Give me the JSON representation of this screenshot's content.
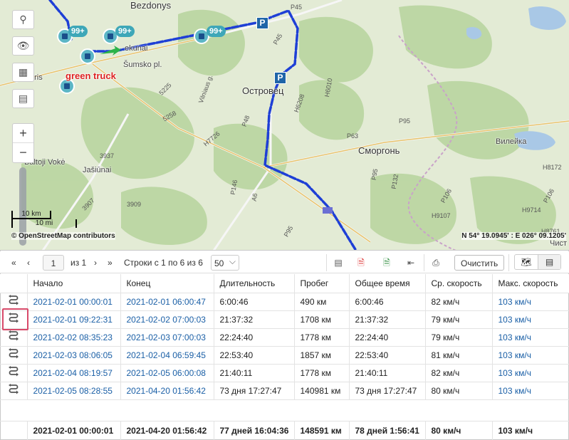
{
  "map": {
    "places": {
      "bezdonys": "Bezdonys",
      "ostrovets": "Островец",
      "smorgon": "Сморгонь",
      "vileyka": "Вилейка",
      "baltoji_voke": "Baltoji Vokė",
      "jasiunai": "Jašiūnai",
      "vilnius_partial": "L",
      "paris_partial": "aris",
      "sumsko": "Šumsko pl.",
      "vilnius_g": "Vilniaus g.",
      "kunai": "ekunai",
      "chist": "Чист"
    },
    "roads": [
      "P45",
      "P45",
      "H6010",
      "H6208",
      "P48",
      "P95",
      "P63",
      "P95",
      "P132",
      "H7726",
      "5225",
      "5258",
      "3937",
      "3907",
      "3909",
      "P146",
      "A6",
      "P95",
      "P106",
      "H9107",
      "H9714",
      "H8172",
      "H8761",
      "P106"
    ],
    "truck_label": "green truck",
    "badges": [
      "99+",
      "99+",
      "99+"
    ],
    "parking_label": "P",
    "scale_km": "10 km",
    "scale_mi": "10 mi",
    "attribution": "© OpenStreetMap contributors",
    "coordinates": "N 54° 19.0945' : E 026° 09.1205'"
  },
  "toolbar": {
    "page_value": "1",
    "page_of": "из 1",
    "rows_info": "Строки с 1 по 6 из 6",
    "rows_per_page": "50",
    "clear_label": "Очистить"
  },
  "table": {
    "headers": [
      "Начало",
      "Конец",
      "Длительность",
      "Пробег",
      "Общее время",
      "Ср. скорость",
      "Макс. скорость"
    ],
    "rows": [
      {
        "start": "2021-02-01 00:00:01",
        "end": "2021-02-01 06:00:47",
        "duration": "6:00:46",
        "mileage": "490 км",
        "total": "6:00:46",
        "avg": "82 км/ч",
        "max": "103 км/ч"
      },
      {
        "start": "2021-02-01 09:22:31",
        "end": "2021-02-02 07:00:03",
        "duration": "21:37:32",
        "mileage": "1708 км",
        "total": "21:37:32",
        "avg": "79 км/ч",
        "max": "103 км/ч"
      },
      {
        "start": "2021-02-02 08:35:23",
        "end": "2021-02-03 07:00:03",
        "duration": "22:24:40",
        "mileage": "1778 км",
        "total": "22:24:40",
        "avg": "79 км/ч",
        "max": "103 км/ч"
      },
      {
        "start": "2021-02-03 08:06:05",
        "end": "2021-02-04 06:59:45",
        "duration": "22:53:40",
        "mileage": "1857 км",
        "total": "22:53:40",
        "avg": "81 км/ч",
        "max": "103 км/ч"
      },
      {
        "start": "2021-02-04 08:19:57",
        "end": "2021-02-05 06:00:08",
        "duration": "21:40:11",
        "mileage": "1778 км",
        "total": "21:40:11",
        "avg": "82 км/ч",
        "max": "103 км/ч"
      },
      {
        "start": "2021-02-05 08:28:55",
        "end": "2021-04-20 01:56:42",
        "duration": "73 дня 17:27:47",
        "mileage": "140981 км",
        "total": "73 дня 17:27:47",
        "avg": "80 км/ч",
        "max": "103 км/ч"
      }
    ],
    "totals": {
      "start": "2021-02-01 00:00:01",
      "end": "2021-04-20 01:56:42",
      "duration": "77 дней 16:04:36",
      "mileage": "148591 км",
      "total": "78 дней 1:56:41",
      "avg": "80 км/ч",
      "max": "103 км/ч"
    }
  },
  "icons": {
    "search": "search-icon",
    "eye": "eye-icon",
    "layers": "map-layers-icon",
    "contact": "contact-card-icon",
    "trip": "route-icon",
    "columns": "columns-icon",
    "pdf": "pdf-icon",
    "excel": "excel-icon",
    "export": "export-icon",
    "print": "print-icon",
    "map_view": "map-view-icon",
    "table_view": "table-view-icon"
  },
  "colors": {
    "route": "#1e3fd6",
    "link": "#1a5fa6",
    "highlight": "#d84a6a",
    "truck_label": "#dd2222",
    "badge": "#3ea7b8"
  }
}
